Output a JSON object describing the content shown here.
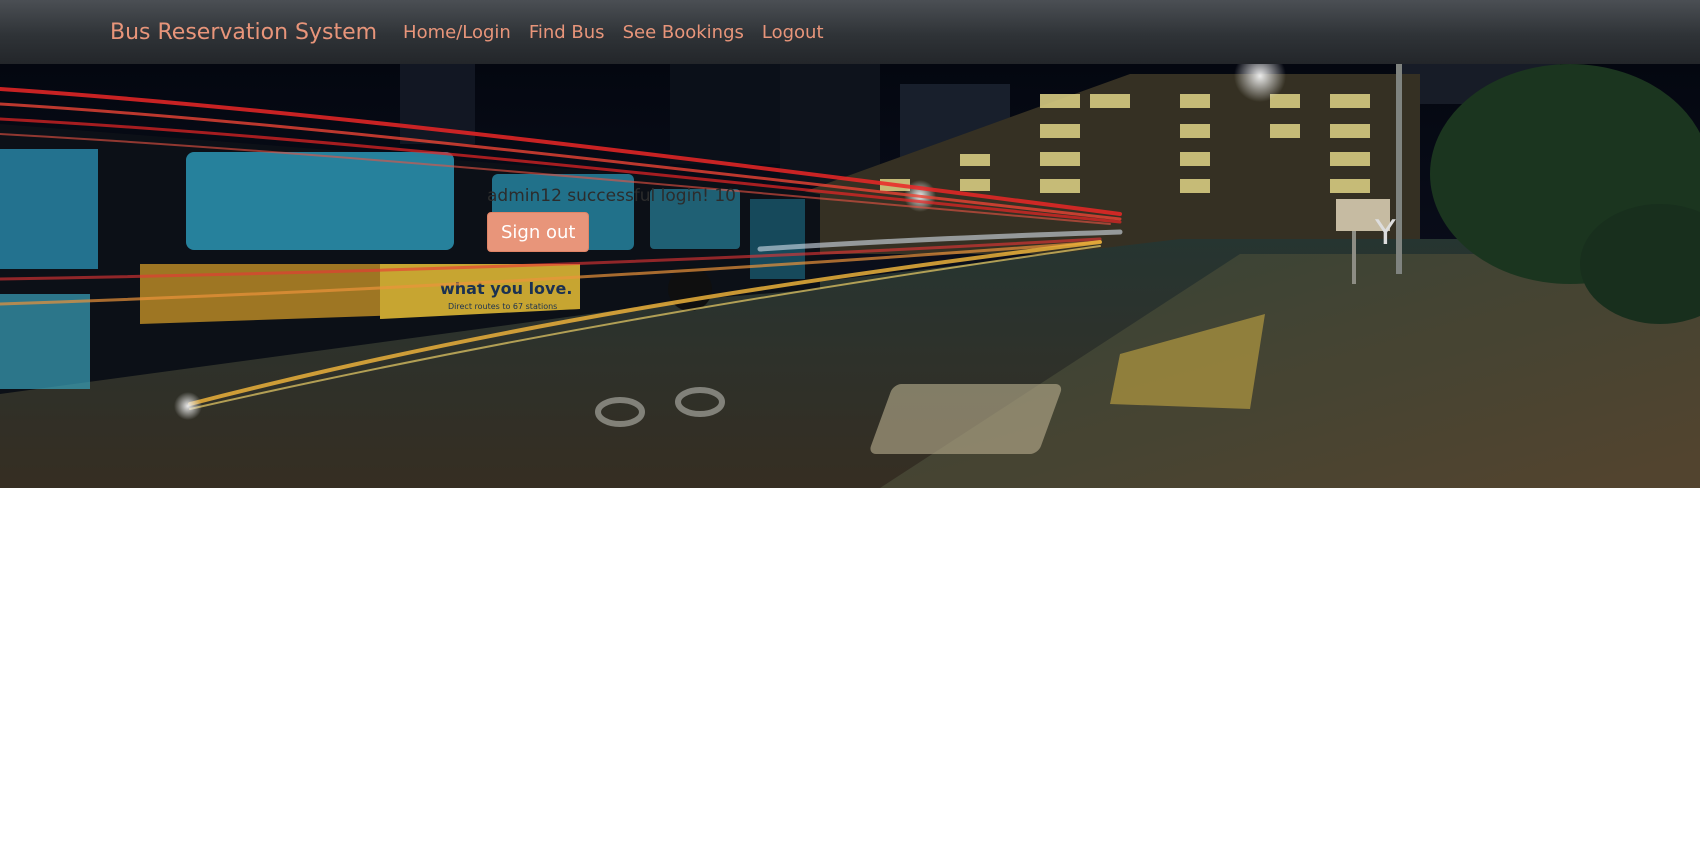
{
  "navbar": {
    "brand": "Bus Reservation System",
    "links": [
      "Home/Login",
      "Find Bus",
      "See Bookings",
      "Logout"
    ]
  },
  "hero": {
    "image_subject": "bus-at-night-city-street",
    "bus_ad_text": "what you love.",
    "bus_ad_subtext": "Direct routes to 67 stations",
    "sign_text": "Y"
  },
  "main": {
    "message": "admin12 successful login! 10",
    "signout_label": "Sign out"
  },
  "colors": {
    "accent": "#e8957a",
    "navbar": "#2f3337",
    "background": "#ffffff"
  }
}
